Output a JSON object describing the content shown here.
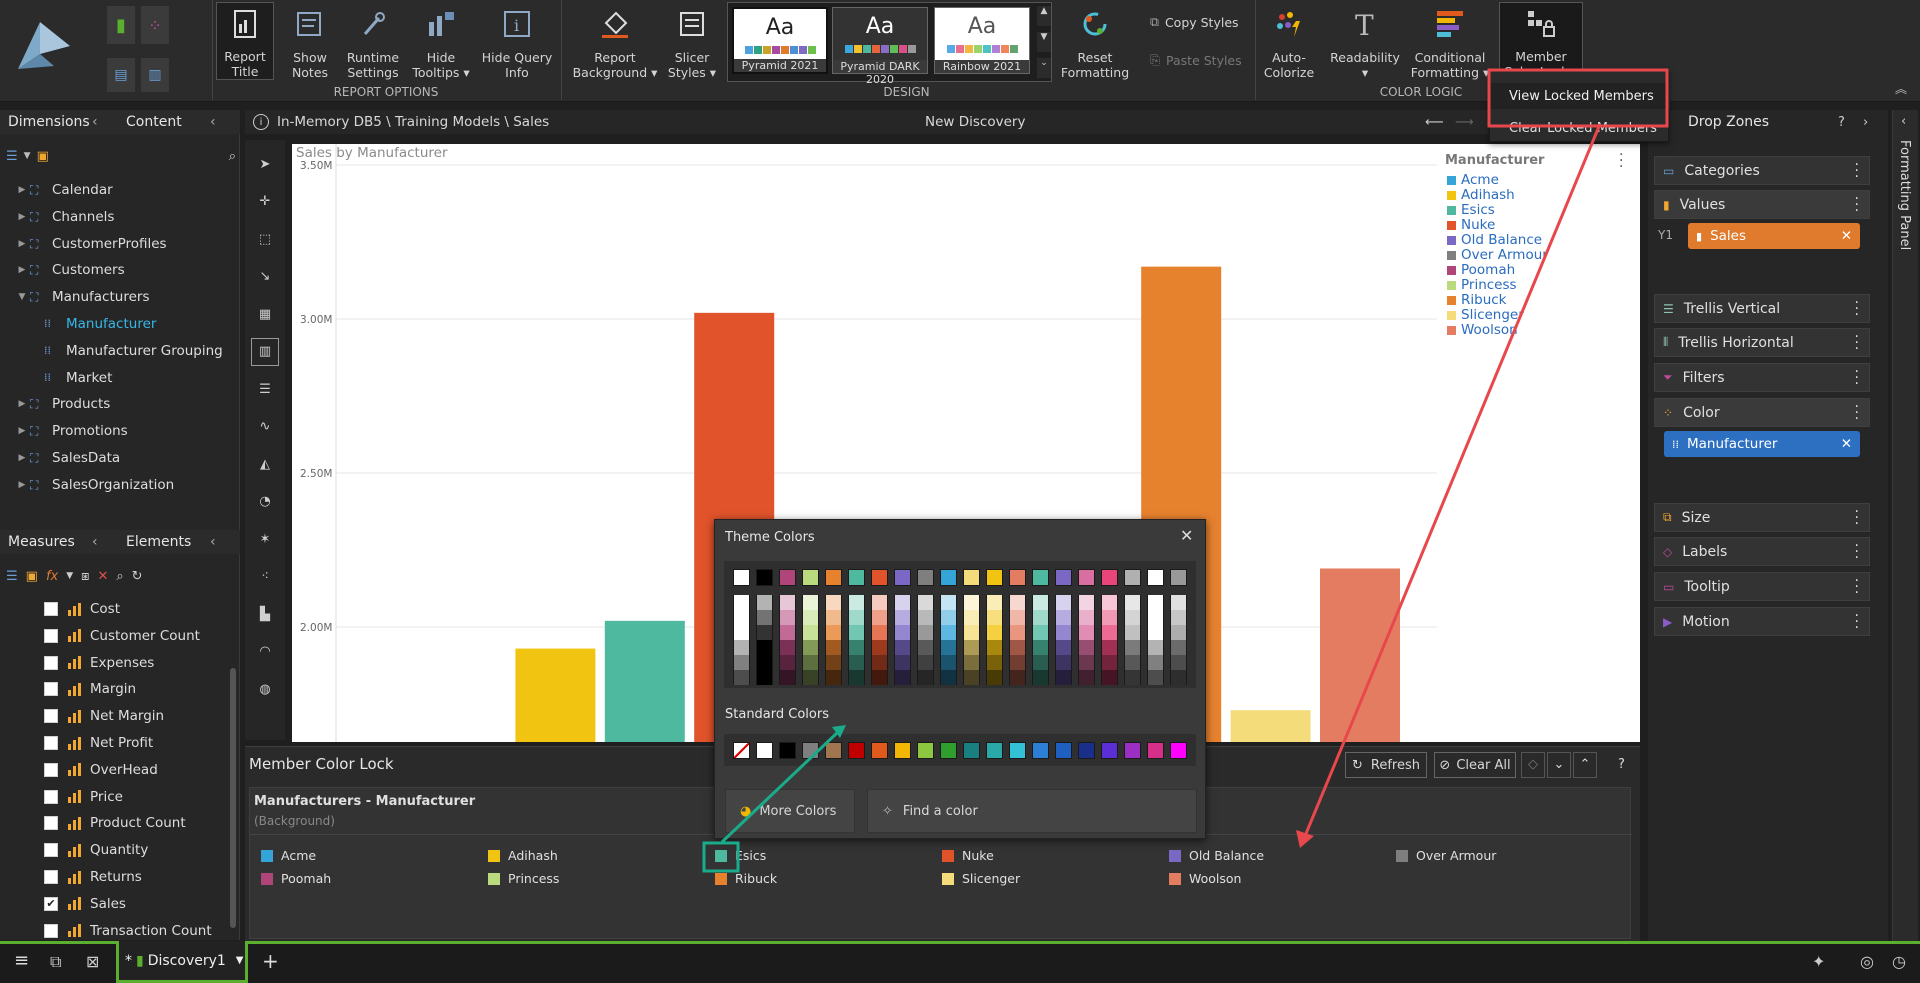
{
  "ribbon": {
    "report_options": {
      "group_label": "REPORT OPTIONS",
      "buttons": [
        {
          "label": "Report\nTitle",
          "icon": "report-title-icon"
        },
        {
          "label": "Show\nNotes",
          "icon": "notes-icon"
        },
        {
          "label": "Runtime\nSettings",
          "icon": "wrench-icon"
        },
        {
          "label": "Hide\nTooltips ▾",
          "icon": "tooltip-icon"
        },
        {
          "label": "Hide Query\nInfo",
          "icon": "info-icon"
        }
      ]
    },
    "design": {
      "group_label": "DESIGN",
      "buttons": [
        {
          "label": "Report\nBackground ▾",
          "icon": "paint-bucket-icon"
        },
        {
          "label": "Slicer\nStyles ▾",
          "icon": "slicer-icon"
        }
      ],
      "themes": [
        {
          "name": "Pyramid 2021",
          "sample": "Aa",
          "colors": [
            "#4aa3df",
            "#2fa37f",
            "#c9a227",
            "#a84aa0",
            "#e07b2d",
            "#4c8fd6",
            "#7f6bc0",
            "#6cbf4b"
          ]
        },
        {
          "name": "Pyramid DARK 2020",
          "sample": "Aa",
          "colors": [
            "#3fa7e0",
            "#f2c12e",
            "#4db89a",
            "#e3643d",
            "#8a6cc7",
            "#5fbf56",
            "#d94f8a",
            "#999999"
          ]
        },
        {
          "name": "Rainbow 2021",
          "sample": "Aa",
          "colors": [
            "#5aa9e6",
            "#e86f8d",
            "#f3b63f",
            "#9bd46b",
            "#4dc3c3",
            "#b07fd6",
            "#f0855b",
            "#64a36f"
          ]
        }
      ],
      "reset": "Reset\nFormatting",
      "copy_styles": "Copy Styles",
      "paste_styles": "Paste Styles"
    },
    "color_logic": {
      "group_label": "COLOR LOGIC",
      "buttons": [
        {
          "label": "Auto-\nColorize",
          "icon": "auto-colorize-icon"
        },
        {
          "label": "Readability ▾",
          "icon": "readability-icon"
        },
        {
          "label": "Conditional\nFormatting ▾",
          "icon": "conditional-formatting-icon"
        },
        {
          "label": "Member\nColor Lock ▾",
          "icon": "member-color-lock-icon"
        }
      ]
    },
    "dropdown": {
      "items": [
        "View Locked Members",
        "Clear Locked Members"
      ]
    }
  },
  "left_panel": {
    "tabs": [
      "Dimensions",
      "Content"
    ],
    "tree": [
      {
        "label": "Calendar",
        "level": 0,
        "expanded": false
      },
      {
        "label": "Channels",
        "level": 0,
        "expanded": false
      },
      {
        "label": "CustomerProfiles",
        "level": 0,
        "expanded": false
      },
      {
        "label": "Customers",
        "level": 0,
        "expanded": false
      },
      {
        "label": "Manufacturers",
        "level": 0,
        "expanded": true
      },
      {
        "label": "Manufacturer",
        "level": 1,
        "selected": true
      },
      {
        "label": "Manufacturer Grouping",
        "level": 1
      },
      {
        "label": "Market",
        "level": 1
      },
      {
        "label": "Products",
        "level": 0,
        "expanded": false
      },
      {
        "label": "Promotions",
        "level": 0,
        "expanded": false
      },
      {
        "label": "SalesData",
        "level": 0,
        "expanded": false
      },
      {
        "label": "SalesOrganization",
        "level": 0,
        "expanded": false
      }
    ],
    "measures_tabs": [
      "Measures",
      "Elements"
    ],
    "measures": [
      {
        "label": "Cost",
        "checked": false
      },
      {
        "label": "Customer Count",
        "checked": false
      },
      {
        "label": "Expenses",
        "checked": false
      },
      {
        "label": "Margin",
        "checked": false
      },
      {
        "label": "Net Margin",
        "checked": false
      },
      {
        "label": "Net Profit",
        "checked": false
      },
      {
        "label": "OverHead",
        "checked": false
      },
      {
        "label": "Price",
        "checked": false
      },
      {
        "label": "Product Count",
        "checked": false
      },
      {
        "label": "Quantity",
        "checked": false
      },
      {
        "label": "Returns",
        "checked": false
      },
      {
        "label": "Sales",
        "checked": true
      },
      {
        "label": "Transaction Count",
        "checked": false
      }
    ]
  },
  "header": {
    "path": "In-Memory DB5 \\ Training Models \\ Sales",
    "title": "New Discovery"
  },
  "chart_data": {
    "type": "bar",
    "title": "Sales by Manufacturer",
    "legend_title": "Manufacturer",
    "legend_position": "right",
    "y_ticks": [
      "3.50M",
      "3.00M",
      "2.50M",
      "2.00M"
    ],
    "ylim": [
      1600000,
      3500000
    ],
    "grid": true,
    "categories": [
      "Acme",
      "Adihash",
      "Esics",
      "Nuke",
      "Old Balance",
      "Over Armour",
      "Poomah",
      "Princess",
      "Ribuck",
      "Slicenger",
      "Woolson"
    ],
    "colors": [
      "#35a5d8",
      "#f2c412",
      "#4fb99f",
      "#e0532b",
      "#7b68c4",
      "#7f7f7f",
      "#b0457a",
      "#b9db7e",
      "#e6812e",
      "#f5dc7a",
      "#e47c62"
    ],
    "values": [
      null,
      1930000,
      2020000,
      3020000,
      null,
      null,
      null,
      null,
      3170000,
      1730000,
      2190000
    ]
  },
  "drop_zones": {
    "title": "Drop Zones",
    "zones": [
      "Categories",
      "Values",
      "Trellis Vertical",
      "Trellis Horizontal",
      "Filters",
      "Color",
      "Size",
      "Labels",
      "Tooltip",
      "Motion"
    ],
    "values_chip": "Sales",
    "color_chip": "Manufacturer",
    "y_label": "Y1",
    "side_tab": "Formatting Panel"
  },
  "color_picker": {
    "theme_title": "Theme Colors",
    "standard_title": "Standard Colors",
    "more_colors": "More Colors",
    "find_color": "Find a color",
    "theme_top": [
      "#ffffff",
      "#000000",
      "#b0457a",
      "#b9db7e",
      "#e6812e",
      "#4fb99f",
      "#e0532b",
      "#7b68c4",
      "#7f7f7f",
      "#35a5d8",
      "#f5dc7a",
      "#f2c412",
      "#e47c62",
      "#4fb99f",
      "#7b68c4",
      "#d86fa0",
      "#e8457a",
      "#b0b0b0",
      "#ffffff",
      "#999999"
    ],
    "standard": [
      "#ffffff",
      "#000000",
      "#7f7f7f",
      "#a0764f",
      "#c00000",
      "#e05a1e",
      "#f2b705",
      "#8dc63f",
      "#2e9e2e",
      "#1a7f7f",
      "#2aa8a8",
      "#33c1d6",
      "#2d7fd6",
      "#1f5fbf",
      "#1a2f8a",
      "#5a2fd6",
      "#9b2fc4",
      "#d62f8a",
      "#ff00ff"
    ]
  },
  "member_color_lock": {
    "title": "Member Color Lock",
    "refresh": "Refresh",
    "clear_all": "Clear All",
    "section_title": "Manufacturers - Manufacturer",
    "section_sub": "(Background)",
    "members": [
      {
        "label": "Acme",
        "color": "#35a5d8"
      },
      {
        "label": "Adihash",
        "color": "#f2c412"
      },
      {
        "label": "Esics",
        "color": "#4fb99f"
      },
      {
        "label": "Nuke",
        "color": "#e0532b"
      },
      {
        "label": "Old Balance",
        "color": "#7b68c4"
      },
      {
        "label": "Over Armour",
        "color": "#7f7f7f"
      },
      {
        "label": "Poomah",
        "color": "#b0457a"
      },
      {
        "label": "Princess",
        "color": "#b9db7e"
      },
      {
        "label": "Ribuck",
        "color": "#e6812e"
      },
      {
        "label": "Slicenger",
        "color": "#f5dc7a"
      },
      {
        "label": "Woolson",
        "color": "#e47c62"
      }
    ]
  },
  "statusbar": {
    "tab_label": "Discovery1",
    "tab_modified": "*"
  }
}
